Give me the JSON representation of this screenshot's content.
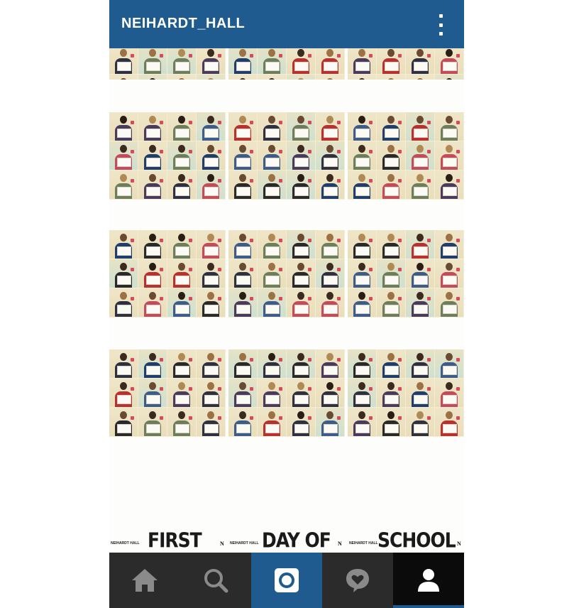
{
  "app": {
    "username": "NEIHARDT_HALL",
    "accent_color": "#1f5b8f",
    "menu_icon": "kebab-menu-icon"
  },
  "post": {
    "caption_words": [
      "FIRST",
      "DAY OF",
      "SCHOOL"
    ],
    "watermark_text": "NEIHARDT HALL",
    "watermark_logo": "N"
  },
  "navbar": {
    "items": [
      {
        "icon": "home-icon"
      },
      {
        "icon": "search-icon"
      },
      {
        "icon": "camera-icon",
        "active": true
      },
      {
        "icon": "activity-icon"
      },
      {
        "icon": "profile-icon",
        "selected": true
      }
    ]
  }
}
